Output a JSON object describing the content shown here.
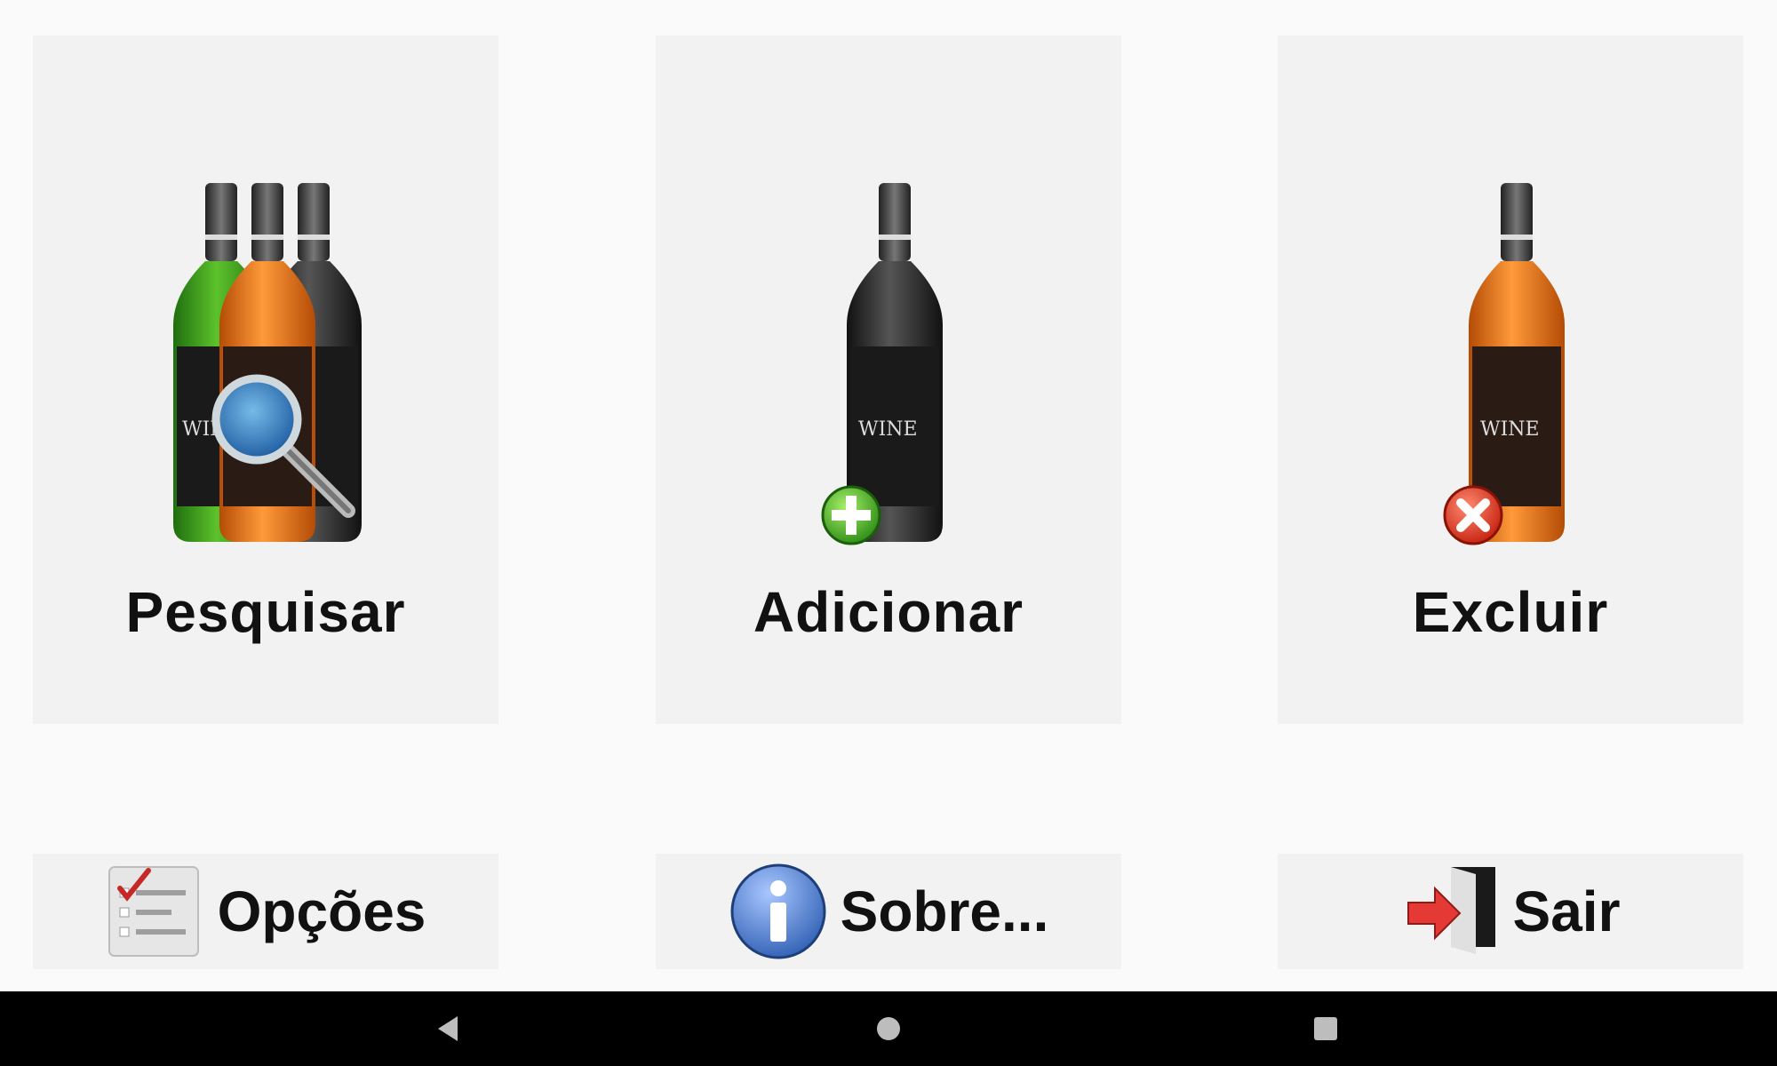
{
  "main_tiles": [
    {
      "label": "Pesquisar",
      "icon": "wine-bottles-search-icon"
    },
    {
      "label": "Adicionar",
      "icon": "wine-bottle-add-icon"
    },
    {
      "label": "Excluir",
      "icon": "wine-bottle-delete-icon"
    }
  ],
  "bottom_tiles": [
    {
      "label": "Opções",
      "icon": "checklist-icon"
    },
    {
      "label": "Sobre...",
      "icon": "info-icon"
    },
    {
      "label": "Sair",
      "icon": "exit-door-icon"
    }
  ],
  "bottle_label_text": "WINE",
  "nav": {
    "back": "back-icon",
    "home": "home-icon",
    "recents": "recents-icon"
  },
  "colors": {
    "background": "#fafafa",
    "tile": "#f2f2f2",
    "navbar": "#000000",
    "bottle_green": "#3a9b1e",
    "bottle_orange": "#e8771c",
    "bottle_black": "#2b2b2b"
  }
}
